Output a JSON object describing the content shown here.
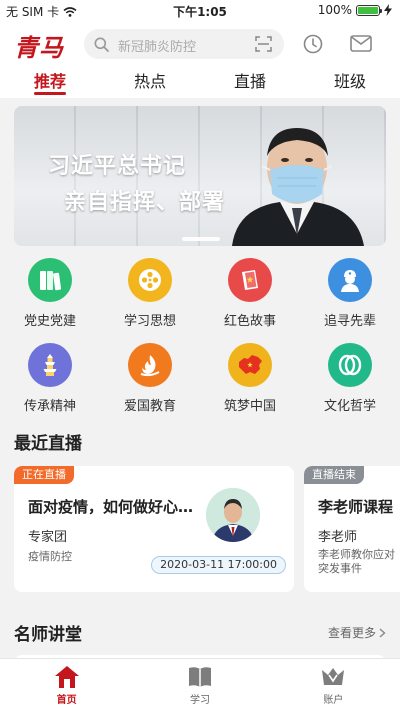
{
  "status": {
    "carrier": "无 SIM 卡",
    "time": "下午1:05",
    "battery": "100%",
    "battery_level": 1.0
  },
  "header": {
    "logo_text": "青马",
    "search_placeholder": "新冠肺炎防控",
    "icons": [
      "search-icon",
      "scan-icon",
      "history-clock-icon",
      "mail-icon"
    ]
  },
  "tabs": [
    {
      "label": "推荐",
      "active": true
    },
    {
      "label": "热点",
      "active": false
    },
    {
      "label": "直播",
      "active": false
    },
    {
      "label": "班级",
      "active": false
    }
  ],
  "banner": {
    "line1": "习近平总书记",
    "line2": "亲自指挥、部署"
  },
  "grid": [
    {
      "label": "党史党建",
      "icon": "books-icon",
      "color": "#2bbf73"
    },
    {
      "label": "学习思想",
      "icon": "film-reel-icon",
      "color": "#f2b51d"
    },
    {
      "label": "红色故事",
      "icon": "red-book-icon",
      "color": "#e84a4a"
    },
    {
      "label": "追寻先辈",
      "icon": "soldier-icon",
      "color": "#3d8fe0"
    },
    {
      "label": "传承精神",
      "icon": "pagoda-icon",
      "color": "#6f72d8"
    },
    {
      "label": "爱国教育",
      "icon": "flame-icon",
      "color": "#f07a1d"
    },
    {
      "label": "筑梦中国",
      "icon": "china-map-icon",
      "color": "#f1b31b"
    },
    {
      "label": "文化哲学",
      "icon": "leaf-icon",
      "color": "#21b98a"
    }
  ],
  "recent_live": {
    "title": "最近直播",
    "cards": [
      {
        "badge": "正在直播",
        "badge_color": "#f26b2a",
        "title": "面对疫情，如何做好心…",
        "speaker": "专家团",
        "tag": "疫情防控",
        "time": "2020-03-11 17:00:00"
      },
      {
        "badge": "直播结束",
        "badge_color": "#8a8f96",
        "title": "李老师课程",
        "speaker": "李老师",
        "tag": "李老师教你应对突发事件"
      }
    ]
  },
  "teacher_hall": {
    "title": "名师讲堂",
    "more": "查看更多"
  },
  "nav": [
    {
      "label": "首页",
      "icon": "home-icon",
      "active": true
    },
    {
      "label": "学习",
      "icon": "book-icon",
      "active": false
    },
    {
      "label": "账户",
      "icon": "crown-icon",
      "active": false
    }
  ],
  "colors": {
    "brand": "#c4161c",
    "background": "#f2f2f2"
  }
}
